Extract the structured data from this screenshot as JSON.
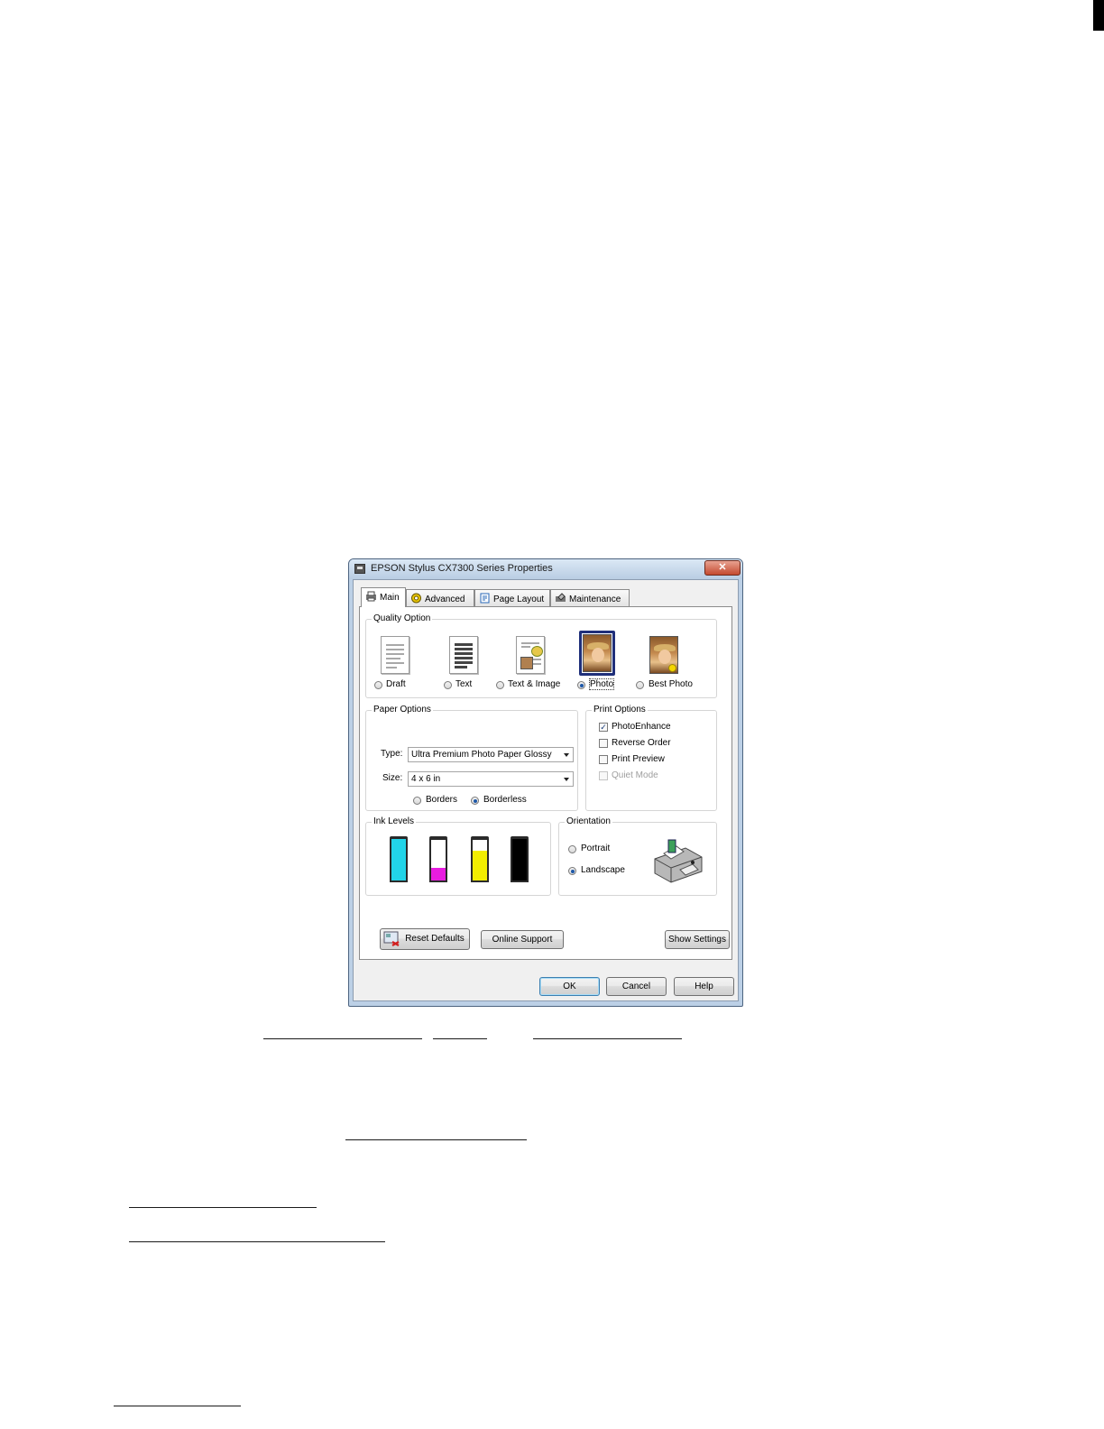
{
  "dialog": {
    "title": "EPSON Stylus CX7300 Series  Properties",
    "close_glyph": "✕",
    "tabs": [
      {
        "label": "Main",
        "icon": "printer-icon"
      },
      {
        "label": "Advanced",
        "icon": "gear-icon"
      },
      {
        "label": "Page Layout",
        "icon": "layout-icon"
      },
      {
        "label": "Maintenance",
        "icon": "maintenance-icon"
      }
    ],
    "quality": {
      "title": "Quality Option",
      "options": [
        {
          "label": "Draft",
          "selected": false
        },
        {
          "label": "Text",
          "selected": false
        },
        {
          "label": "Text & Image",
          "selected": false
        },
        {
          "label": "Photo",
          "selected": true
        },
        {
          "label": "Best Photo",
          "selected": false
        }
      ]
    },
    "paper": {
      "title": "Paper Options",
      "type_label": "Type:",
      "type_value": "Ultra Premium Photo Paper Glossy",
      "size_label": "Size:",
      "size_value": "4 x 6 in",
      "borders_label": "Borders",
      "borderless_label": "Borderless",
      "borderless_selected": true
    },
    "print_options": {
      "title": "Print Options",
      "items": [
        {
          "label": "PhotoEnhance",
          "checked": true,
          "enabled": true
        },
        {
          "label": "Reverse Order",
          "checked": false,
          "enabled": true
        },
        {
          "label": "Print Preview",
          "checked": false,
          "enabled": true
        },
        {
          "label": "Quiet Mode",
          "checked": false,
          "enabled": false
        }
      ],
      "check_glyph": "✓"
    },
    "ink_levels": {
      "title": "Ink Levels",
      "inks": [
        {
          "color": "#22d4e8",
          "level": 1.0
        },
        {
          "color": "#e81ce0",
          "level": 0.3
        },
        {
          "color": "#f2ee00",
          "level": 0.72
        },
        {
          "color": "#000000",
          "level": 1.0
        }
      ]
    },
    "orientation": {
      "title": "Orientation",
      "portrait_label": "Portrait",
      "landscape_label": "Landscape",
      "landscape_selected": true
    },
    "buttons": {
      "reset": "Reset Defaults",
      "online_support": "Online Support",
      "show_settings": "Show Settings",
      "ok": "OK",
      "cancel": "Cancel",
      "help": "Help"
    }
  }
}
